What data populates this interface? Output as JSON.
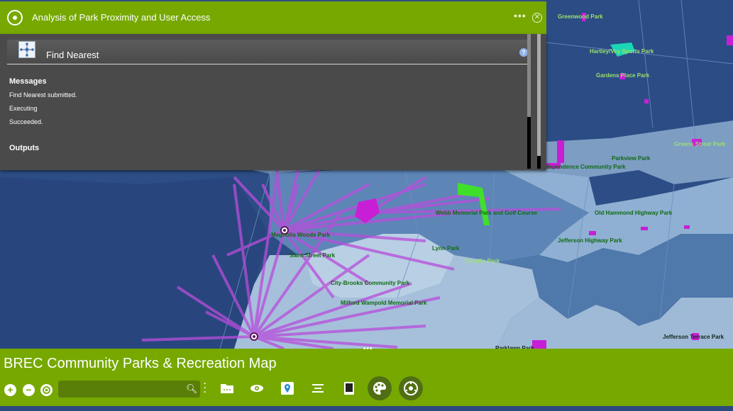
{
  "panel": {
    "title": "Analysis of Park Proximity and User Access",
    "more": "•••",
    "close": "✕",
    "tool_name": "Find Nearest",
    "help": "?",
    "messages_heading": "Messages",
    "messages": [
      "Find Nearest submitted.",
      "Executing",
      "Succeeded."
    ],
    "outputs_heading": "Outputs"
  },
  "map": {
    "labels": [
      "Greenwood Park",
      "Hartley/Vey Sports Park",
      "Gardens Place Park",
      "Greens Street Park",
      "Parkview Park",
      "Independence Community Park",
      "Webb Memorial Park and Golf Course",
      "Old Hammond Highway Park",
      "Magnolia Woods Park",
      "Saint Street Park",
      "Jefferson Highway Park",
      "Drusilla Park",
      "Lynn Park",
      "Saint Street Park",
      "City-Brooks Community Park",
      "Milford Wampold Memorial Park",
      "Jefferson Terrace Park",
      "Parklawn Park"
    ]
  },
  "toolbar": {
    "app_title": "BREC Community Parks & Recreation Map",
    "handle": "•••",
    "zoom_in": "+",
    "zoom_out": "−",
    "search_placeholder": "",
    "tools": [
      "folder-icon",
      "layers-icon",
      "map-pin-icon",
      "list-icon",
      "book-icon",
      "palette-icon",
      "analysis-icon"
    ]
  },
  "colors": {
    "brand_green": "#76a800",
    "panel_gray": "#4a4a4a",
    "map_dark_blue": "#2e4f86",
    "route_purple": "#b84ddb",
    "park_magenta": "#c81fd6"
  }
}
